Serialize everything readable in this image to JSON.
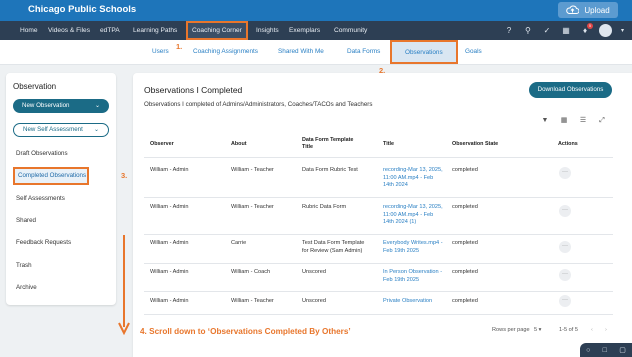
{
  "topbar": {
    "brand": "Chicago Public Schools",
    "upload_label": "Upload"
  },
  "nav": {
    "items": [
      "Home",
      "Videos & Files",
      "edTPA",
      "Learning Paths",
      "Coaching Corner",
      "Insights",
      "Exemplars",
      "Community"
    ],
    "active": "Coaching Corner",
    "badge": "5"
  },
  "subnav": {
    "items": [
      "Users",
      "Coaching Assignments",
      "Shared With Me",
      "Data Forms",
      "Observations",
      "Goals"
    ],
    "active": "Observations"
  },
  "steps": {
    "one": "1.",
    "two": "2.",
    "three": "3.",
    "four": "4."
  },
  "sidebar": {
    "title": "Observation",
    "new_observation": "New Observation",
    "new_self_assessment": "New Self Assessment",
    "items": [
      "Draft Observations",
      "Completed Observations",
      "Self Assessments",
      "Shared",
      "Feedback Requests",
      "Trash",
      "Archive"
    ],
    "active": "Completed Observations"
  },
  "main": {
    "title": "Observations I Completed",
    "subtitle": "Observations I completed of Admins/Administrators, Coaches/TACOs and Teachers",
    "download_label": "Download Observations",
    "columns": [
      "Observer",
      "About",
      "Data Form Template Title",
      "Title",
      "Observation State",
      "Actions"
    ],
    "rows": [
      {
        "observer": "William - Admin",
        "about": "William - Teacher",
        "form": "Data Form Rubric Test",
        "title": "recording-Mar 13, 2025, 11:00 AM.mp4 - Feb 14th 2024",
        "state": "completed"
      },
      {
        "observer": "William - Admin",
        "about": "William - Teacher",
        "form": "Rubric Data Form",
        "title": "recording-Mar 13, 2025, 11:00 AM.mp4 - Feb 14th 2024 (1)",
        "state": "completed"
      },
      {
        "observer": "William - Admin",
        "about": "Carrie",
        "form": "Test Data Form Template for Review (Sam Admin)",
        "title": "Everybody Writes.mp4 - Feb 19th 2025",
        "state": "completed"
      },
      {
        "observer": "William - Admin",
        "about": "William - Coach",
        "form": "Unscored",
        "title": "In Person Observation - Feb 19th 2025",
        "state": "completed"
      },
      {
        "observer": "William - Admin",
        "about": "William - Teacher",
        "form": "Unscored",
        "title": "Private Observation",
        "state": "completed"
      }
    ],
    "rows_per_page_label": "Rows per page",
    "rows_per_page": "5",
    "range": "1-5 of 5"
  },
  "annotation": {
    "scroll_note": "Scroll down to ‘Observations Completed By Others’"
  },
  "colors": {
    "brand_blue": "#1e75ba",
    "nav_dark": "#2d3f54",
    "accent_orange": "#e8762c",
    "button_teal": "#1b6b86",
    "link_blue": "#2b80c4"
  },
  "icons": [
    "cloud-upload-icon",
    "help-icon",
    "search-icon",
    "lightning-icon",
    "calendar-icon",
    "bell-icon",
    "avatar",
    "filter-icon",
    "grid-view-icon",
    "list-view-icon",
    "fullscreen-icon",
    "more-icon"
  ]
}
